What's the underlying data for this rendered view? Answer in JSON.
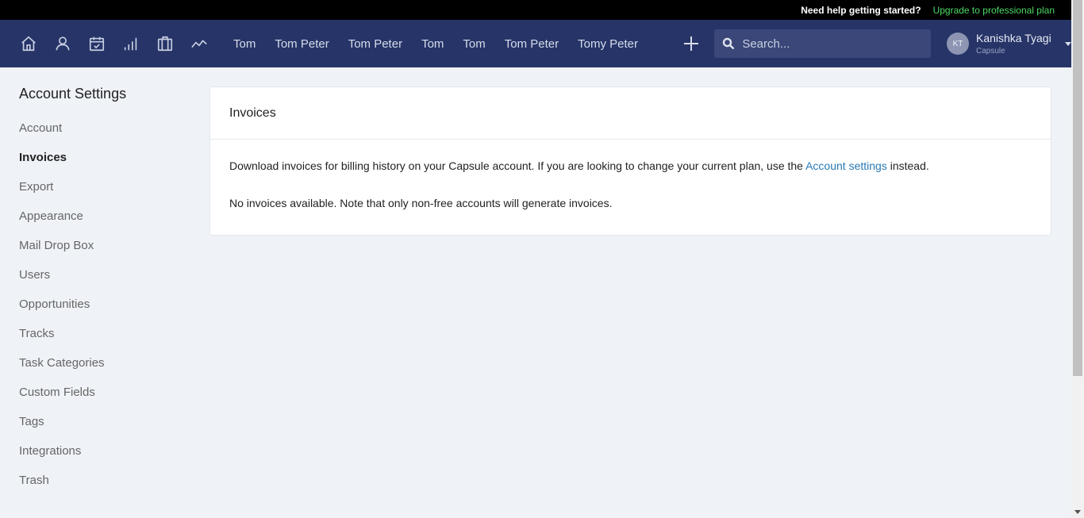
{
  "topbar": {
    "help": "Need help getting started?",
    "upgrade": "Upgrade to professional plan"
  },
  "nav": {
    "icons": [
      "home-icon",
      "person-icon",
      "calendar-check-icon",
      "signal-bars-icon",
      "briefcase-icon",
      "activity-icon"
    ],
    "links": [
      "Tom",
      "Tom Peter",
      "Tom Peter",
      "Tom",
      "Tom",
      "Tom Peter",
      "Tomy Peter"
    ],
    "search_placeholder": "Search...",
    "user": {
      "initials": "KT",
      "name": "Kanishka Tyagi",
      "org": "Capsule"
    }
  },
  "sidebar": {
    "title": "Account Settings",
    "items": [
      "Account",
      "Invoices",
      "Export",
      "Appearance",
      "Mail Drop Box",
      "Users",
      "Opportunities",
      "Tracks",
      "Task Categories",
      "Custom Fields",
      "Tags",
      "Integrations",
      "Trash"
    ],
    "active": "Invoices"
  },
  "main": {
    "title": "Invoices",
    "desc_before": "Download invoices for billing history on your Capsule account. If you are looking to change your current plan, use the ",
    "desc_link": "Account settings",
    "desc_after": " instead.",
    "empty": "No invoices available. Note that only non-free accounts will generate invoices."
  }
}
